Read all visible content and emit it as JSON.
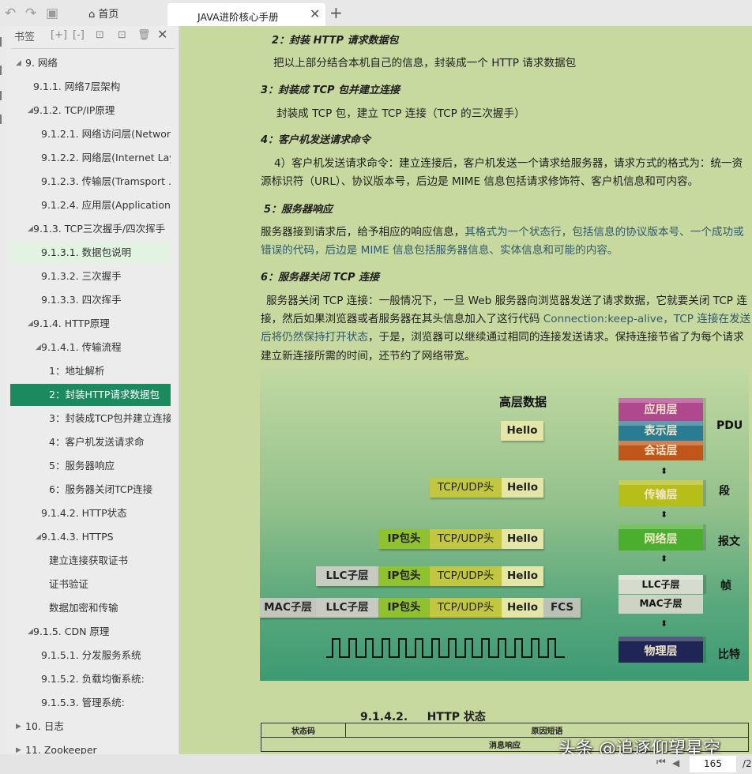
{
  "toolbar": {
    "undo": "↶",
    "redo": "↷",
    "save": "▣",
    "home_icon": "⌂",
    "home_label": "首页",
    "active_tab": "JAVA进阶核心手册",
    "close": "✕",
    "new_tab": "+"
  },
  "sidebar": {
    "title": "书签",
    "icons": [
      "[+]",
      "[-]",
      "⊡",
      "⊡",
      "🗑",
      "✕"
    ],
    "items": [
      {
        "label": "9. 网络",
        "level": 0,
        "arrow": "◢"
      },
      {
        "label": "9.1.1. 网络7层架构",
        "level": 1,
        "arrow": ""
      },
      {
        "label": "9.1.2. TCP/IP原理",
        "level": 1,
        "arrow": "◢"
      },
      {
        "label": "9.1.2.1. 网络访问层(Networ...",
        "level": 2,
        "arrow": ""
      },
      {
        "label": "9.1.2.2. 网络层(Internet Lay...",
        "level": 2,
        "arrow": ""
      },
      {
        "label": "9.1.2.3. 传输层(Tramsport ...",
        "level": 2,
        "arrow": ""
      },
      {
        "label": "9.1.2.4. 应用层(Application...",
        "level": 2,
        "arrow": ""
      },
      {
        "label": "9.1.3. TCP三次握手/四次挥手",
        "level": 1,
        "arrow": "◢"
      },
      {
        "label": "9.1.3.1. 数据包说明",
        "level": 2,
        "arrow": "",
        "state": "hover"
      },
      {
        "label": "9.1.3.2. 三次握手",
        "level": 2,
        "arrow": ""
      },
      {
        "label": "9.1.3.3. 四次挥手",
        "level": 2,
        "arrow": ""
      },
      {
        "label": "9.1.4. HTTP原理",
        "level": 1,
        "arrow": "◢"
      },
      {
        "label": "9.1.4.1. 传输流程",
        "level": 2,
        "arrow": "◢"
      },
      {
        "label": "1：地址解析",
        "level": 3,
        "arrow": ""
      },
      {
        "label": "2：封装HTTP请求数据包",
        "level": 3,
        "arrow": "",
        "state": "sel"
      },
      {
        "label": "3：封装成TCP包并建立连接",
        "level": 3,
        "arrow": ""
      },
      {
        "label": "4：客户机发送请求命",
        "level": 3,
        "arrow": ""
      },
      {
        "label": "5：服务器响应",
        "level": 3,
        "arrow": ""
      },
      {
        "label": "6：服务器关闭TCP连接",
        "level": 3,
        "arrow": ""
      },
      {
        "label": "9.1.4.2. HTTP状态",
        "level": 2,
        "arrow": ""
      },
      {
        "label": "9.1.4.3. HTTPS",
        "level": 2,
        "arrow": "◢"
      },
      {
        "label": "建立连接获取证书",
        "level": 3,
        "arrow": ""
      },
      {
        "label": "证书验证",
        "level": 3,
        "arrow": ""
      },
      {
        "label": "数据加密和传输",
        "level": 3,
        "arrow": ""
      },
      {
        "label": "9.1.5. CDN 原理",
        "level": 1,
        "arrow": "◢"
      },
      {
        "label": "9.1.5.1. 分发服务系统",
        "level": 2,
        "arrow": ""
      },
      {
        "label": "9.1.5.2. 负载均衡系统:",
        "level": 2,
        "arrow": ""
      },
      {
        "label": "9.1.5.3. 管理系统:",
        "level": 2,
        "arrow": ""
      },
      {
        "label": "10. 日志",
        "level": 0,
        "arrow": "▶"
      },
      {
        "label": "11. Zookeeper",
        "level": 0,
        "arrow": "▶"
      }
    ]
  },
  "doc": {
    "h2": "2：封装 HTTP 请求数据包",
    "p2": "把以上部分结合本机自己的信息，封装成一个 HTTP 请求数据包",
    "h3": "3：封装成 TCP 包并建立连接",
    "p3": "封装成 TCP 包，建立 TCP 连接（TCP 的三次握手）",
    "h4": "4：客户机发送请求命令",
    "p4a": "4）客户机发送请求命令：建立连接后，客户机发送一个请求给服务器，请求方式的格式为：统一资",
    "p4b": "源标识符（URL）、协议版本号，后边是 MIME 信息包括请求修饰符、客户机信息和可内容。",
    "h5": "5：服务器响应",
    "p5a1": "服务器接到请求后，给予相应的响应信息，",
    "p5a2": "其格式为一个状态行，包括信息的协议版本号、一个成功或",
    "p5b": "错误的代码，后边是 MIME 信息包括服务器信息、实体信息和可能的内容。",
    "h6": "6：服务器关闭 TCP 连接",
    "p6a": "服务器关闭 TCP 连接：一般情况下，一旦 Web 服务器向浏览器发送了请求数据，它就要关闭 TCP 连",
    "p6b1": "接，然后如果浏览器或者服务器在其头信息加入了这行代码 ",
    "p6b2": "Connection:keep-alive，TCP 连接在发送",
    "p6c1": "后将仍然保持打开状态",
    "p6c2": "，于是，浏览器可以继续通过相同的连接发送请求。保持连接节省了为每个请求",
    "p6d": "建立新连接所需的时间，还节约了网络带宽。",
    "diagram": {
      "title": "高层数据",
      "hello": "Hello",
      "tcp": "TCP/UDP头",
      "ip": "IP包头",
      "llc": "LLC子层",
      "mac": "MAC子层",
      "fcs": "FCS",
      "layers": {
        "app": "应用层",
        "pres": "表示层",
        "sess": "会话层",
        "trans": "传输层",
        "net": "网络层",
        "llc": "LLC子层",
        "mac": "MAC子层",
        "phys": "物理层"
      },
      "pdu": {
        "top": "PDU",
        "seg": "段",
        "pkt": "报文",
        "frame": "帧",
        "bit": "比特"
      },
      "colors": {
        "app": "#b0488e",
        "pres": "#2a7c93",
        "sess": "#c0561a",
        "trans": "#b6be1a",
        "net": "#4cae2e",
        "llc": "#d6dccd",
        "phys": "#1f2555"
      }
    },
    "section": "9.1.4.2.     HTTP 状态",
    "table": {
      "h1": "状态码",
      "h2": "原因短语",
      "r1": "消息响应"
    },
    "watermark": "头条 @追逐仰望星空"
  },
  "pager": {
    "first": "⏮",
    "prev": "◀",
    "page": "165",
    "total": "/2"
  }
}
